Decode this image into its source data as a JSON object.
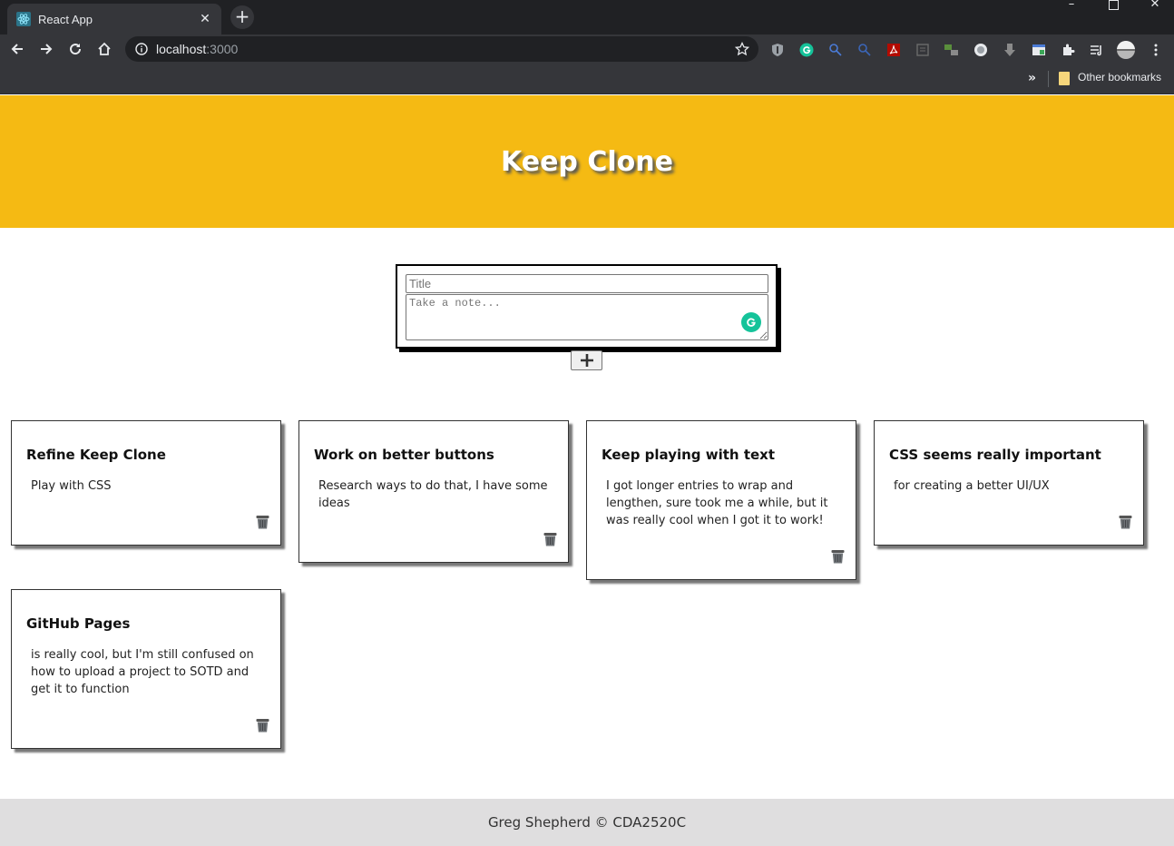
{
  "browser": {
    "tab": {
      "title": "React App",
      "favicon": "react-icon"
    },
    "address": {
      "host": "localhost",
      "port": ":3000"
    },
    "bookmarks": {
      "overflow": "»",
      "other_label": "Other bookmarks"
    }
  },
  "app": {
    "title": "Keep Clone",
    "form": {
      "title_placeholder": "Title",
      "note_placeholder": "Take a note..."
    },
    "add_icon": "plus-icon",
    "notes": [
      {
        "title": "Refine Keep Clone",
        "content": "Play with CSS"
      },
      {
        "title": "Work on better buttons",
        "content": "Research ways to do that, I have some ideas"
      },
      {
        "title": "Keep playing with text",
        "content": "I got longer entries to wrap and lengthen, sure took me a while, but it was really cool when I got it to work!"
      },
      {
        "title": "CSS seems really important",
        "content": "for creating a better UI/UX"
      },
      {
        "title": "GitHub Pages",
        "content": "is really cool, but I'm still confused on how to upload a project to SOTD and get it to function"
      }
    ],
    "footer": "Greg Shepherd © CDA2520C"
  },
  "colors": {
    "header_bg": "#f5ba13",
    "footer_bg": "#dfdedf",
    "grammarly": "#15c39a"
  }
}
